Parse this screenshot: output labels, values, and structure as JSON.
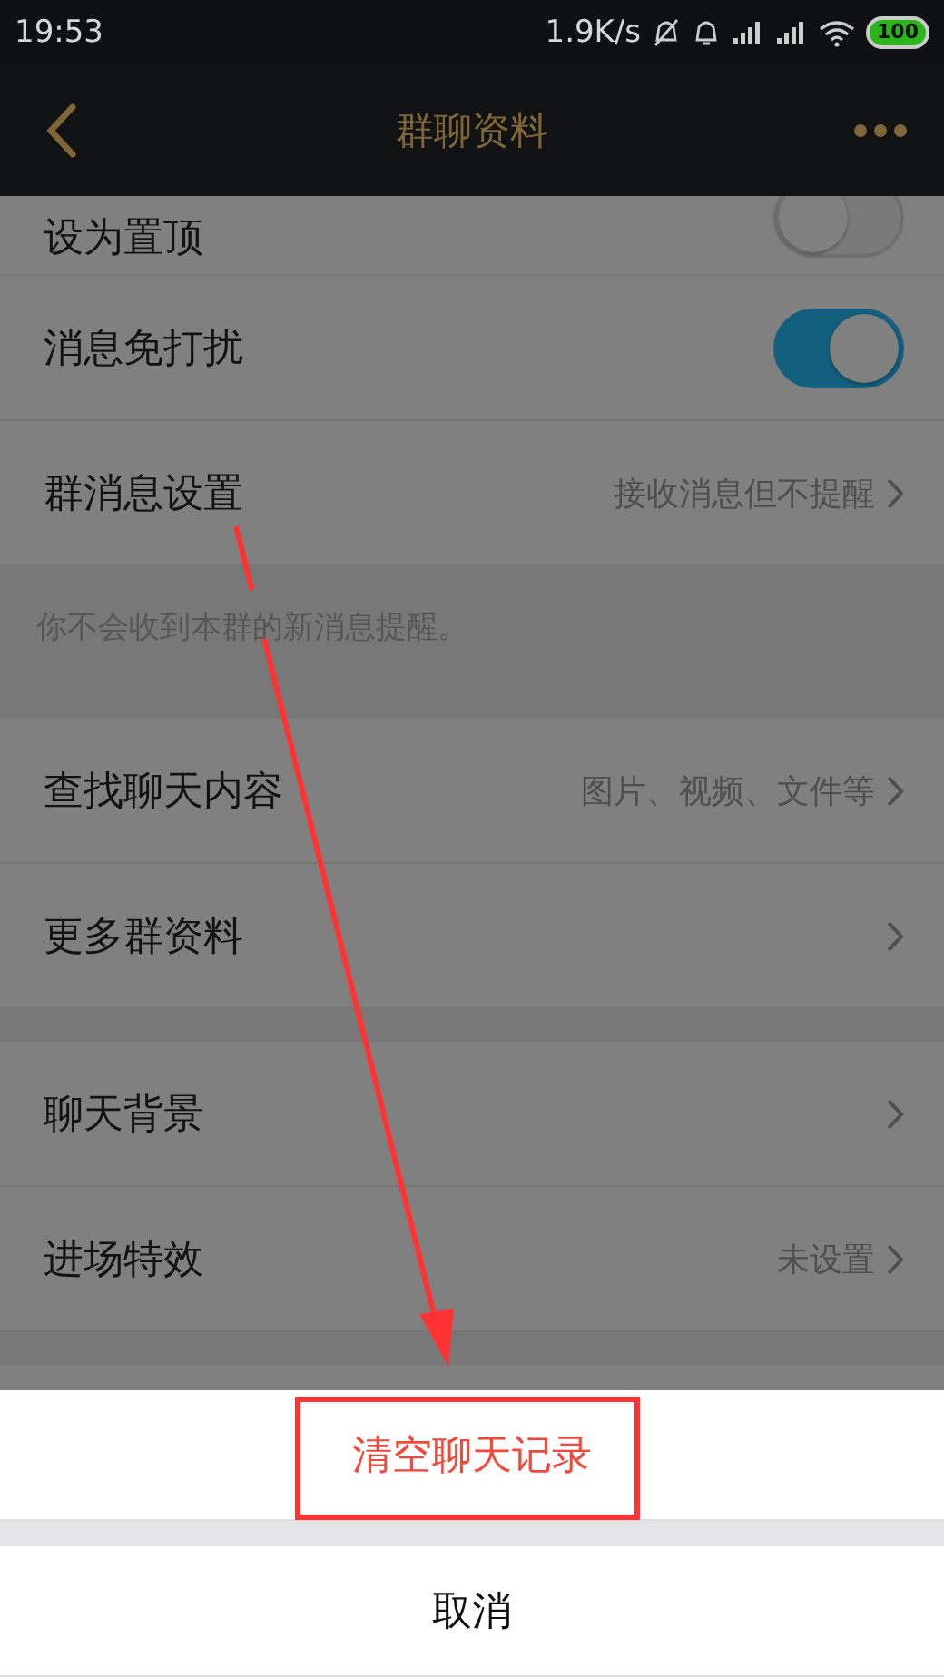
{
  "status_bar": {
    "time": "19:53",
    "net_speed": "1.9K/s",
    "battery": "100"
  },
  "nav": {
    "title": "群聊资料"
  },
  "sections": [
    {
      "rows": [
        {
          "kind": "toggle",
          "label": "设为置顶",
          "on": false
        },
        {
          "kind": "toggle",
          "label": "消息免打扰",
          "on": true
        },
        {
          "kind": "link",
          "label": "群消息设置",
          "value": "接收消息但不提醒"
        }
      ],
      "note": "你不会收到本群的新消息提醒。"
    },
    {
      "rows": [
        {
          "kind": "link",
          "label": "查找聊天内容",
          "value": "图片、视频、文件等"
        },
        {
          "kind": "link",
          "label": "更多群资料"
        }
      ]
    },
    {
      "rows": [
        {
          "kind": "link",
          "label": "聊天背景"
        },
        {
          "kind": "link",
          "label": "进场特效",
          "value": "未设置"
        }
      ]
    }
  ],
  "action_sheet": {
    "items": [
      {
        "kind": "destructive",
        "label": "清空聊天记录"
      }
    ],
    "cancel": "取消"
  }
}
